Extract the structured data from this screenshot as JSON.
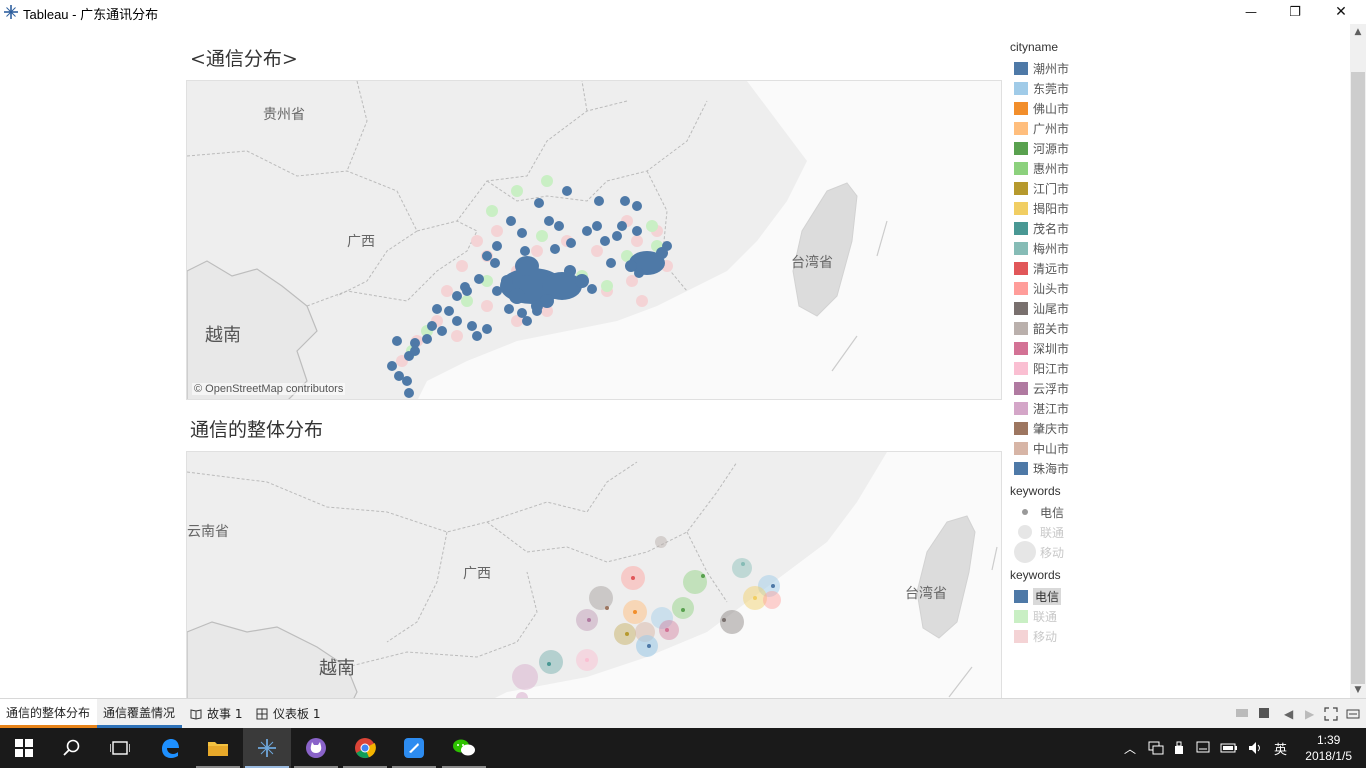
{
  "window": {
    "title": "Tableau - 广东通讯分布",
    "minimize_glyph": "—",
    "maximize_glyph": "❐",
    "close_glyph": "✕"
  },
  "sheet1": {
    "title": "<通信分布>",
    "attribution": "© OpenStreetMap contributors",
    "labels": {
      "guizhou": "贵州省",
      "guangxi": "广西",
      "vietnam": "越南",
      "taiwan": "台湾省"
    }
  },
  "sheet2": {
    "title": "通信的整体分布",
    "labels": {
      "yunnan": "云南省",
      "guangxi": "广西",
      "vietnam": "越南",
      "taiwan": "台湾省"
    }
  },
  "legend_city": {
    "title": "cityname",
    "items": [
      {
        "label": "潮州市",
        "color": "#4e79a7"
      },
      {
        "label": "东莞市",
        "color": "#a0cbe8"
      },
      {
        "label": "佛山市",
        "color": "#f28e2b"
      },
      {
        "label": "广州市",
        "color": "#ffbe7d"
      },
      {
        "label": "河源市",
        "color": "#59a14f"
      },
      {
        "label": "惠州市",
        "color": "#8cd17d"
      },
      {
        "label": "江门市",
        "color": "#b6992d"
      },
      {
        "label": "揭阳市",
        "color": "#f1ce63"
      },
      {
        "label": "茂名市",
        "color": "#499894"
      },
      {
        "label": "梅州市",
        "color": "#86bcb6"
      },
      {
        "label": "清远市",
        "color": "#e15759"
      },
      {
        "label": "汕头市",
        "color": "#ff9d9a"
      },
      {
        "label": "汕尾市",
        "color": "#79706e"
      },
      {
        "label": "韶关市",
        "color": "#bab0ac"
      },
      {
        "label": "深圳市",
        "color": "#d37295"
      },
      {
        "label": "阳江市",
        "color": "#fabfd2"
      },
      {
        "label": "云浮市",
        "color": "#b07aa1"
      },
      {
        "label": "湛江市",
        "color": "#d4a6c8"
      },
      {
        "label": "肇庆市",
        "color": "#9d7660"
      },
      {
        "label": "中山市",
        "color": "#d7b5a6"
      },
      {
        "label": "珠海市",
        "color": "#4e79a7"
      }
    ]
  },
  "legend_size": {
    "title": "keywords",
    "items": [
      {
        "label": "电信",
        "dim": false
      },
      {
        "label": "联通",
        "dim": true
      },
      {
        "label": "移动",
        "dim": true
      }
    ]
  },
  "legend_color": {
    "title": "keywords",
    "items": [
      {
        "label": "电信",
        "color": "#4e79a7",
        "dim": false,
        "selected": true
      },
      {
        "label": "联通",
        "color": "#c9efc4",
        "dim": true,
        "selected": false
      },
      {
        "label": "移动",
        "color": "#f4d3d5",
        "dim": true,
        "selected": false
      }
    ]
  },
  "tabs": [
    {
      "label": "通信的整体分布",
      "icon": "",
      "active": true
    },
    {
      "label": "通信覆盖情况",
      "icon": "",
      "active": false
    },
    {
      "label": "故事 1",
      "icon": "story-icon",
      "active": false
    },
    {
      "label": "仪表板 1",
      "icon": "dashboard-icon",
      "active": false
    }
  ],
  "taskbar": {
    "time": "1:39",
    "date": "2018/1/5",
    "ime": "英"
  }
}
